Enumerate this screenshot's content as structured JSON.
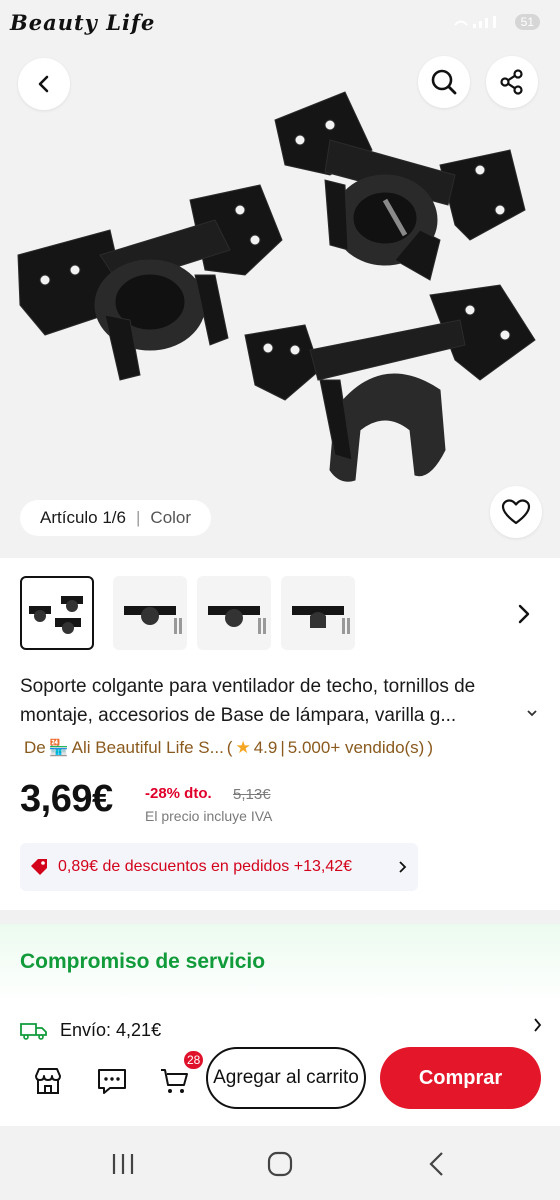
{
  "brand": "Beauty Life",
  "status": {
    "battery": "51"
  },
  "gallery": {
    "counter": "Artículo 1/6",
    "divider": "|",
    "color_label": "Color"
  },
  "product": {
    "title": "Soporte colgante para ventilador de techo, tornillos de montaje, accesorios de Base de lámpara, varilla g...",
    "store_prefix": "De",
    "store_name": "Ali Beautiful Life S...",
    "rating": "4.9",
    "sold": "5.000+ vendido(s)",
    "price": "3,69€",
    "discount": "-28% dto.",
    "old_price": "5,13€",
    "vat_note": "El precio incluye IVA",
    "coupon": "0,89€ de descuentos en pedidos +13,42€"
  },
  "service": {
    "title": "Compromiso de servicio",
    "shipping": "Envío: 4,21€"
  },
  "actions": {
    "cart_count": "28",
    "add_to_cart": "Agregar al carrito",
    "buy": "Comprar"
  },
  "colors": {
    "accent": "#e3162a",
    "price_red": "#e0002a",
    "service_green": "#119b3a",
    "store_brown": "#8a5a1e"
  }
}
